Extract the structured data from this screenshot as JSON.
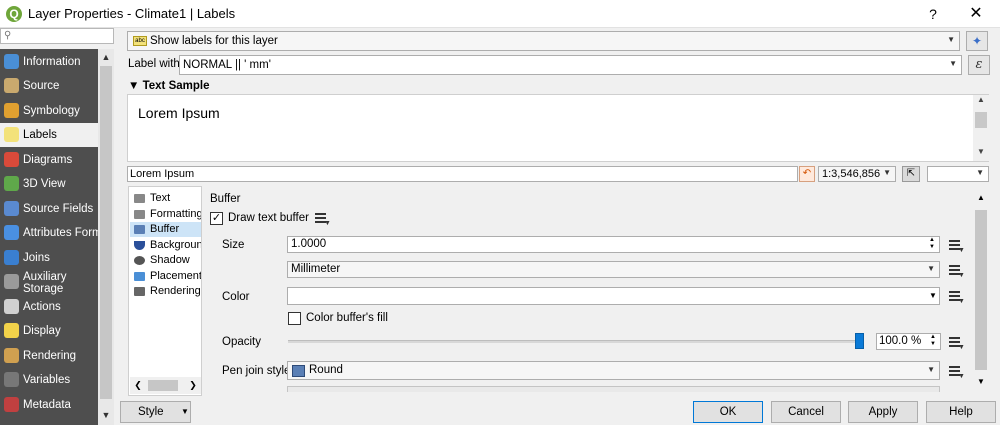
{
  "window": {
    "title": "Layer Properties - Climate1 | Labels",
    "help": "?",
    "close": "✕",
    "logo": "Q"
  },
  "sidebar": {
    "search_icon": "⚲",
    "items": [
      {
        "label": "Information",
        "icon": "info-icon",
        "color": "#4a8fd6"
      },
      {
        "label": "Source",
        "icon": "source-icon",
        "color": "#c9a96e"
      },
      {
        "label": "Symbology",
        "icon": "symbology-icon",
        "color": "#e0a030"
      },
      {
        "label": "Labels",
        "icon": "labels-icon",
        "color": "#f3e27a"
      },
      {
        "label": "Diagrams",
        "icon": "diagrams-icon",
        "color": "#d94a3a"
      },
      {
        "label": "3D View",
        "icon": "3d-view-icon",
        "color": "#5fa84a"
      },
      {
        "label": "Source Fields",
        "icon": "source-fields-icon",
        "color": "#5a8ad0"
      },
      {
        "label": "Attributes Form",
        "icon": "attributes-form-icon",
        "color": "#4a90e2"
      },
      {
        "label": "Joins",
        "icon": "joins-icon",
        "color": "#3a7fd0"
      },
      {
        "label": "Auxiliary\nStorage",
        "icon": "auxiliary-storage-icon",
        "color": "#9a9a9a"
      },
      {
        "label": "Actions",
        "icon": "actions-icon",
        "color": "#d0d0d0"
      },
      {
        "label": "Display",
        "icon": "display-icon",
        "color": "#f2d24a"
      },
      {
        "label": "Rendering",
        "icon": "rendering-icon",
        "color": "#d0a050"
      },
      {
        "label": "Variables",
        "icon": "variables-icon",
        "color": "#777777"
      },
      {
        "label": "Metadata",
        "icon": "metadata-icon",
        "color": "#c04040"
      }
    ]
  },
  "labels_mode": {
    "value": "Show labels for this layer",
    "abc": "abc"
  },
  "label_with": {
    "caption": "Label with",
    "expression": "NORMAL  || ' mm'",
    "expr_button": "ε"
  },
  "text_sample": {
    "header": "Text Sample",
    "preview": "Lorem Ipsum",
    "input": "Lorem Ipsum",
    "scale": "1:3,546,856"
  },
  "tabs": [
    {
      "label": "Text",
      "icon": "text-tab-icon"
    },
    {
      "label": "Formatting",
      "icon": "formatting-tab-icon"
    },
    {
      "label": "Buffer",
      "icon": "buffer-tab-icon"
    },
    {
      "label": "Background",
      "icon": "background-tab-icon"
    },
    {
      "label": "Shadow",
      "icon": "shadow-tab-icon"
    },
    {
      "label": "Placement",
      "icon": "placement-tab-icon"
    },
    {
      "label": "Rendering",
      "icon": "rendering-tab-icon"
    }
  ],
  "buffer": {
    "title": "Buffer",
    "draw_label": "Draw text buffer",
    "size_label": "Size",
    "size_value": "1.0000",
    "unit": "Millimeter",
    "color_label": "Color",
    "color_fill_label": "Color buffer's fill",
    "opacity_label": "Opacity",
    "opacity_value": "100.0 %",
    "opacity_fraction": 1.0,
    "pen_join_label": "Pen join style",
    "pen_join_value": "Round"
  },
  "buttons": {
    "style": "Style",
    "ok": "OK",
    "cancel": "Cancel",
    "apply": "Apply",
    "help": "Help"
  }
}
